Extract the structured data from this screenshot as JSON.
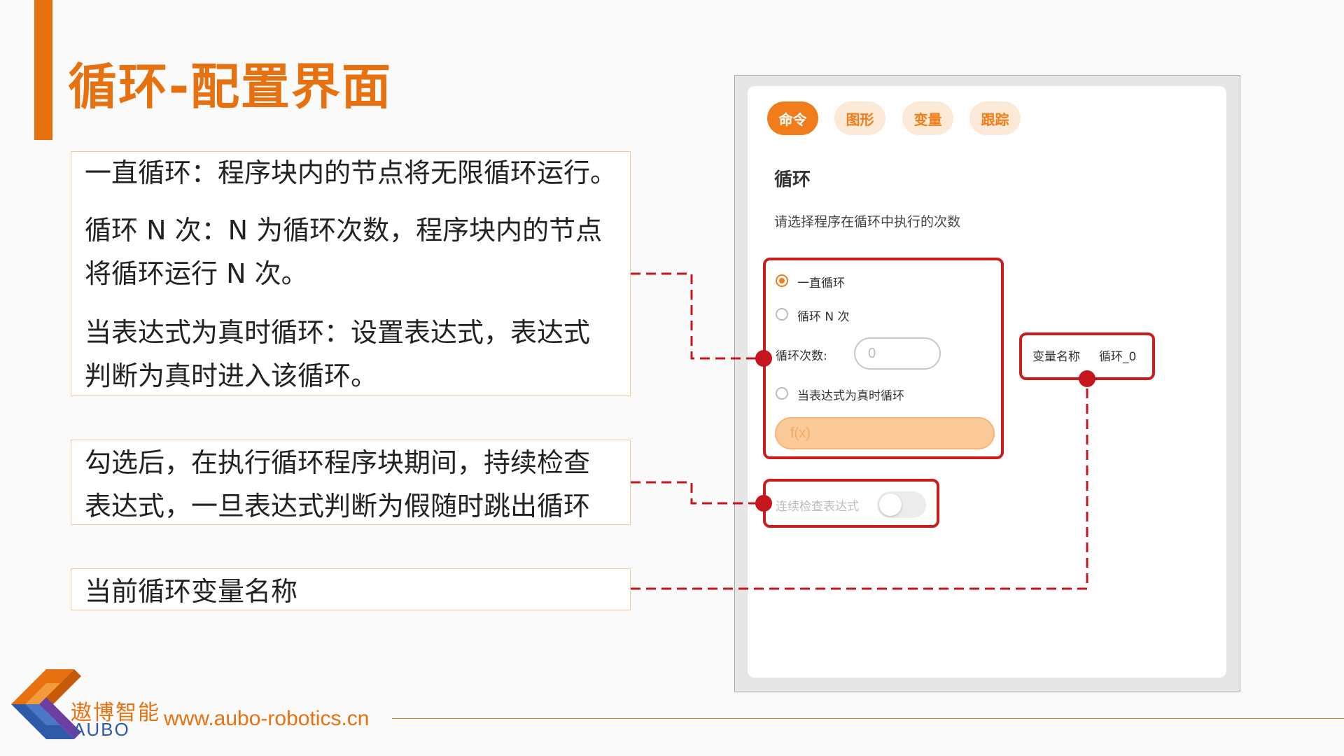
{
  "slide": {
    "title": "循环-配置界面"
  },
  "descriptions": {
    "loop_forever": "一直循环：程序块内的节点将无限循环运行。",
    "loop_n_line1": "循环 N 次：N 为循环次数，程序块内的节点",
    "loop_n_line2": "将循环运行 N 次。",
    "loop_expr_line1": "当表达式为真时循环：设置表达式，表达式",
    "loop_expr_line2": "判断为真时进入该循环。",
    "continuous_line1": "勾选后，在执行循环程序块期间，持续检查",
    "continuous_line2": "表达式，一旦表达式判断为假随时跳出循环",
    "var_name": "当前循环变量名称"
  },
  "panel": {
    "tabs": [
      {
        "label": "命令",
        "active": true
      },
      {
        "label": "图形",
        "active": false
      },
      {
        "label": "变量",
        "active": false
      },
      {
        "label": "跟踪",
        "active": false
      }
    ],
    "section_title": "循环",
    "section_subtitle": "请选择程序在循环中执行的次数",
    "options": {
      "forever": "一直循环",
      "n_times": "循环 N 次",
      "count_label": "循环次数:",
      "count_value": "0",
      "expr_true": "当表达式为真时循环",
      "expr_placeholder": "f(x)"
    },
    "continuous_check_label": "连续检查表达式",
    "variable": {
      "label": "变量名称",
      "value": "循环_0"
    }
  },
  "footer": {
    "brand_cn": "遨博智能",
    "brand_en": "AUBO",
    "url": "www.aubo-robotics.cn"
  },
  "colors": {
    "accent": "#e8710f",
    "tab_active": "#f07d1a",
    "highlight_red": "#cc1d1d",
    "connector_red": "#c4161c",
    "brand_blue": "#2f5aa8"
  }
}
